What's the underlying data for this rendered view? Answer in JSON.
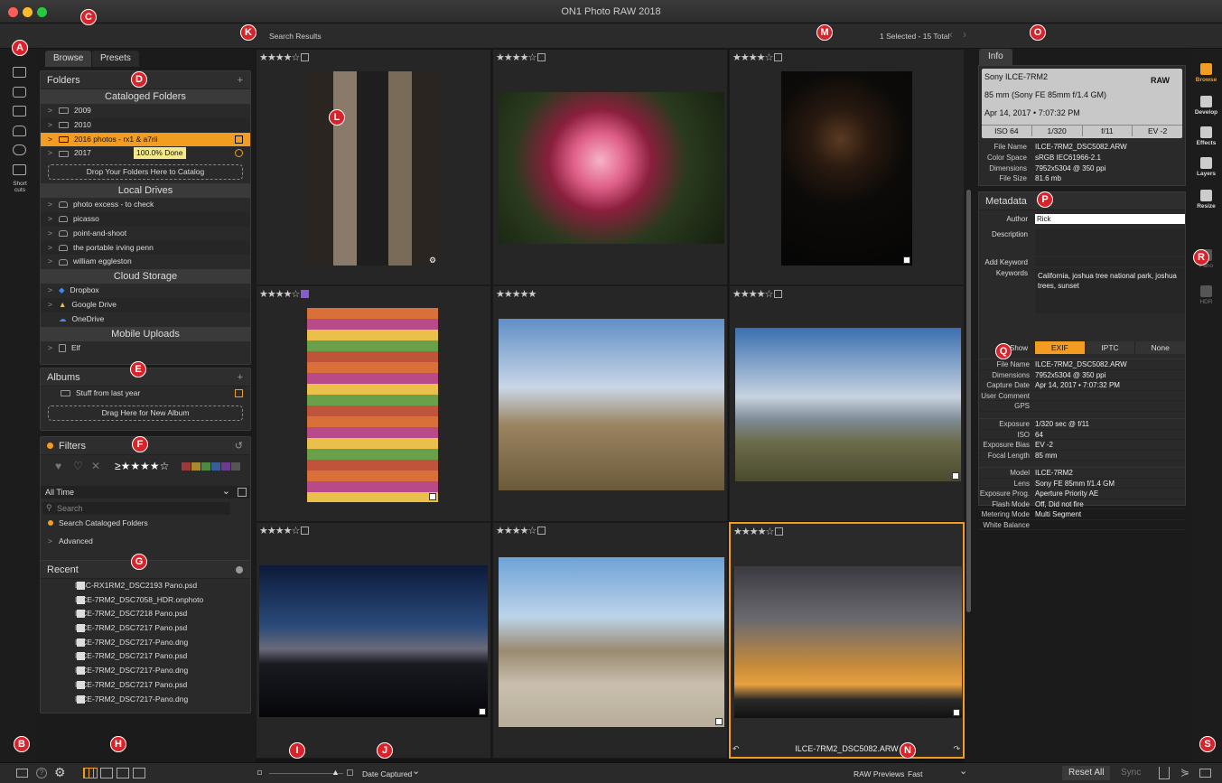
{
  "app": {
    "title": "ON1 Photo RAW 2018"
  },
  "topbar": {
    "search_results": "Search Results",
    "selection_status": "1 Selected - 15 Total"
  },
  "left": {
    "tabs": [
      "Browse",
      "Presets"
    ],
    "folders": {
      "title": "Folders",
      "add": "+",
      "cataloged_header": "Cataloged Folders",
      "cataloged": [
        "2009",
        "2010",
        "2016 photos - rx1 & a7rii",
        "2017"
      ],
      "progress_label": "100.0% Done",
      "drop_label": "Drop Your Folders Here to Catalog",
      "local_header": "Local Drives",
      "local": [
        "photo excess - to check",
        "picasso",
        "point-and-shoot",
        "the portable irving penn",
        "william eggleston"
      ],
      "cloud_header": "Cloud Storage",
      "cloud": [
        "Dropbox",
        "Google Drive",
        "OneDrive"
      ],
      "mobile_header": "Mobile Uploads",
      "mobile": [
        "Elf"
      ]
    },
    "albums": {
      "title": "Albums",
      "add": "+",
      "items": [
        "Stuff from last year"
      ],
      "drag_label": "Drag Here for New Album"
    },
    "filters": {
      "title": "Filters",
      "time": "All Time",
      "search_placeholder": "Search",
      "search_scope": "Search Cataloged Folders",
      "advanced": "Advanced",
      "rating_symbol": "≥★★★★☆"
    },
    "recent": {
      "title": "Recent",
      "items": [
        "DSC-RX1RM2_DSC2193 Pano.psd",
        "ILCE-7RM2_DSC7058_HDR.onphoto",
        "ILCE-7RM2_DSC7218 Pano.psd",
        "ILCE-7RM2_DSC7217 Pano.psd",
        "ILCE-7RM2_DSC7217-Pano.dng",
        "ILCE-7RM2_DSC7217 Pano.psd",
        "ILCE-7RM2_DSC7217-Pano.dng",
        "ILCE-7RM2_DSC7217 Pano.psd",
        "ILCE-7RM2_DSC7217-Pano.dng"
      ]
    }
  },
  "rail": {
    "shortcuts_label": "Short cuts"
  },
  "grid": {
    "cells": [
      {
        "stars": "★★★★☆",
        "alt": "building window"
      },
      {
        "stars": "★★★★☆",
        "alt": "pink flower"
      },
      {
        "stars": "★★★★☆",
        "alt": "bassist"
      },
      {
        "stars": "★★★★☆",
        "alt": "macarons"
      },
      {
        "stars": "★★★★★",
        "alt": "woman in hat"
      },
      {
        "stars": "★★★★☆",
        "alt": "lake landscape"
      },
      {
        "stars": "★★★★☆",
        "alt": "dusk lake"
      },
      {
        "stars": "★★★★☆",
        "alt": "desert rocks"
      },
      {
        "stars": "★★★★☆",
        "alt": "joshua trees"
      }
    ],
    "selected_filename": "ILCE-7RM2_DSC5082.ARW"
  },
  "info": {
    "tab": "Info",
    "camera": "Sony ILCE-7RM2",
    "format": "RAW",
    "lens": "85 mm (Sony FE 85mm f/1.4 GM)",
    "date": "Apr 14, 2017 • 7:07:32 PM",
    "exposure": [
      "ISO 64",
      "1/320",
      "f/11",
      "EV -2"
    ],
    "fields": [
      {
        "k": "File Name",
        "v": "ILCE-7RM2_DSC5082.ARW"
      },
      {
        "k": "Color Space",
        "v": "sRGB IEC61966-2.1"
      },
      {
        "k": "Dimensions",
        "v": "7952x5304 @ 350 ppi"
      },
      {
        "k": "File Size",
        "v": "81.6 mb"
      }
    ]
  },
  "metadata": {
    "title": "Metadata",
    "author_label": "Author",
    "author": "Rick",
    "description_label": "Description",
    "add_keyword_label": "Add Keyword",
    "keywords_label": "Keywords",
    "keywords": "California, joshua tree national park, joshua trees, sunset",
    "show_label": "Show",
    "show_tabs": [
      "EXIF",
      "IPTC",
      "None"
    ],
    "group1": [
      {
        "k": "File Name",
        "v": "ILCE-7RM2_DSC5082.ARW"
      },
      {
        "k": "Dimensions",
        "v": "7952x5304 @ 350 ppi"
      },
      {
        "k": "Capture Date",
        "v": "Apr 14, 2017 • 7:07:32 PM"
      },
      {
        "k": "User Comment",
        "v": ""
      },
      {
        "k": "GPS",
        "v": ""
      }
    ],
    "group2": [
      {
        "k": "Exposure",
        "v": "1/320 sec @ f/11"
      },
      {
        "k": "ISO",
        "v": "64"
      },
      {
        "k": "Exposure Bias",
        "v": "EV -2"
      },
      {
        "k": "Focal Length",
        "v": "85 mm"
      }
    ],
    "group3": [
      {
        "k": "Model",
        "v": "ILCE-7RM2"
      },
      {
        "k": "Lens",
        "v": "Sony FE 85mm f/1.4 GM"
      },
      {
        "k": "Exposure Prog.",
        "v": "Aperture Priority AE"
      },
      {
        "k": "Flash Mode",
        "v": "Off, Did not fire"
      },
      {
        "k": "Metering Mode",
        "v": "Multi Segment"
      },
      {
        "k": "White Balance",
        "v": ""
      }
    ]
  },
  "modules": [
    "Browse",
    "Develop",
    "Effects",
    "Layers",
    "Resize",
    "Pano",
    "HDR"
  ],
  "bottom": {
    "sort": "Date Captured",
    "raw_previews_label": "RAW Previews",
    "raw_previews_value": "Fast",
    "reset_all": "Reset All",
    "sync": "Sync"
  },
  "markers": [
    "A",
    "B",
    "C",
    "D",
    "E",
    "F",
    "G",
    "H",
    "I",
    "J",
    "K",
    "L",
    "M",
    "N",
    "O",
    "P",
    "Q",
    "R",
    "S"
  ],
  "colors": {
    "accent": "#f39c22",
    "marker": "#d8232a"
  }
}
